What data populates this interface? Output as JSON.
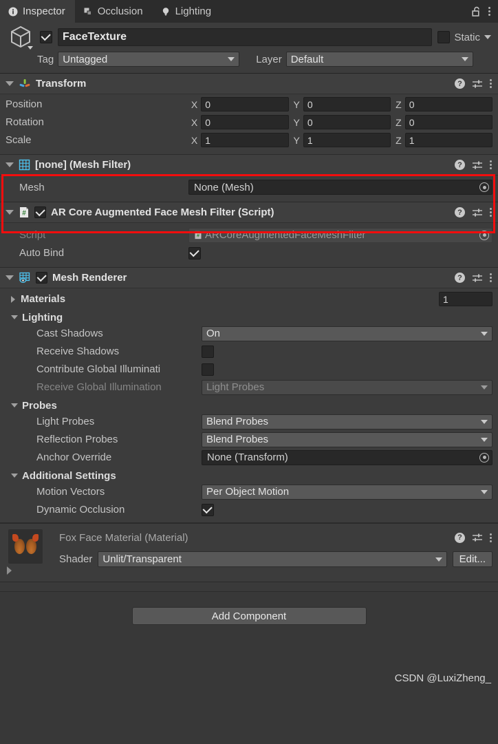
{
  "window": {
    "tabs": [
      {
        "label": "Inspector",
        "icon": "info-icon",
        "active": true
      },
      {
        "label": "Occlusion",
        "icon": "occlusion-icon",
        "active": false
      },
      {
        "label": "Lighting",
        "icon": "lightbulb-icon",
        "active": false
      }
    ],
    "lock_icon": "open-padlock-icon",
    "menu_icon": "kebab-menu-icon"
  },
  "gameobject": {
    "icon": "cube-icon",
    "enabled": true,
    "name": "FaceTexture",
    "static_label": "Static",
    "static_checked": false,
    "tag_label": "Tag",
    "tag_value": "Untagged",
    "layer_label": "Layer",
    "layer_value": "Default"
  },
  "components": {
    "transform": {
      "title": "Transform",
      "icon": "transform-axis-icon",
      "rows": [
        {
          "label": "Position",
          "x": "0",
          "y": "0",
          "z": "0"
        },
        {
          "label": "Rotation",
          "x": "0",
          "y": "0",
          "z": "0"
        },
        {
          "label": "Scale",
          "x": "1",
          "y": "1",
          "z": "1"
        }
      ],
      "axis_labels": {
        "x": "X",
        "y": "Y",
        "z": "Z"
      }
    },
    "mesh_filter": {
      "title": "[none] (Mesh Filter)",
      "icon": "mesh-grid-icon",
      "highlighted": true,
      "highlight_color": "#f40d0d",
      "mesh_label": "Mesh",
      "mesh_value": "None (Mesh)"
    },
    "ar_script": {
      "title": "AR Core Augmented Face Mesh Filter (Script)",
      "icon": "csharp-script-icon",
      "enabled": true,
      "script_label": "Script",
      "script_value": "ARCoreAugmentedFaceMeshFilter",
      "auto_bind_label": "Auto Bind",
      "auto_bind_checked": true
    },
    "mesh_renderer": {
      "title": "Mesh Renderer",
      "icon": "mesh-renderer-icon",
      "enabled": true,
      "materials_label": "Materials",
      "materials_count": "1",
      "lighting_label": "Lighting",
      "cast_shadows_label": "Cast Shadows",
      "cast_shadows_value": "On",
      "receive_shadows_label": "Receive Shadows",
      "receive_shadows_checked": false,
      "contribute_gi_label": "Contribute Global Illuminati",
      "contribute_gi_checked": false,
      "receive_gi_label": "Receive Global Illumination",
      "receive_gi_value": "Light Probes",
      "probes_label": "Probes",
      "light_probes_label": "Light Probes",
      "light_probes_value": "Blend Probes",
      "reflection_probes_label": "Reflection Probes",
      "reflection_probes_value": "Blend Probes",
      "anchor_override_label": "Anchor Override",
      "anchor_override_value": "None (Transform)",
      "additional_settings_label": "Additional Settings",
      "motion_vectors_label": "Motion Vectors",
      "motion_vectors_value": "Per Object Motion",
      "dynamic_occlusion_label": "Dynamic Occlusion",
      "dynamic_occlusion_checked": true
    },
    "material": {
      "title": "Fox Face Material (Material)",
      "icon": "fox-face-material-thumbnail",
      "shader_label": "Shader",
      "shader_value": "Unlit/Transparent",
      "edit_label": "Edit..."
    }
  },
  "footer": {
    "add_component_label": "Add Component",
    "watermark": "CSDN @LuxiZheng_"
  }
}
